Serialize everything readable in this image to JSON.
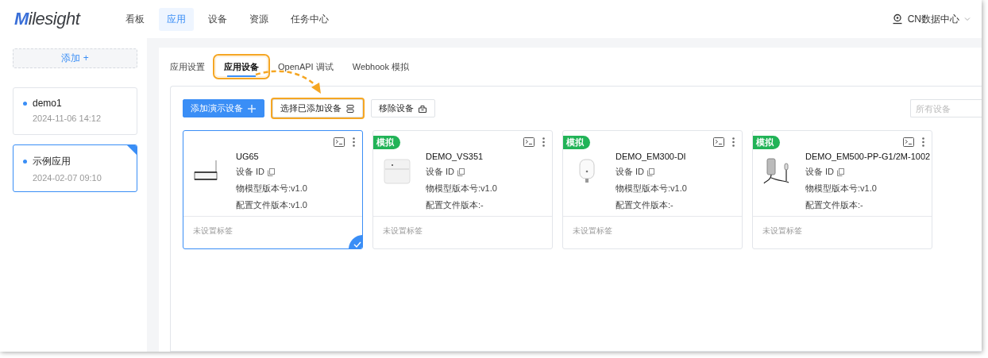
{
  "logo": "Milesight",
  "nav": [
    {
      "label": "看板",
      "selected": false
    },
    {
      "label": "应用",
      "selected": true
    },
    {
      "label": "设备",
      "selected": false
    },
    {
      "label": "资源",
      "selected": false
    },
    {
      "label": "任务中心",
      "selected": false
    }
  ],
  "region": "CN数据中心",
  "sidebar": {
    "add_button": "添加 +",
    "apps": [
      {
        "name": "demo1",
        "date": "2024-11-06 14:12",
        "selected": false
      },
      {
        "name": "示例应用",
        "date": "2024-02-07 09:10",
        "selected": true
      }
    ]
  },
  "tabs": [
    {
      "label": "应用设置",
      "selected": false,
      "highlighted": false
    },
    {
      "label": "应用设备",
      "selected": true,
      "highlighted": true
    },
    {
      "label": "OpenAPI 调试",
      "selected": false,
      "highlighted": false
    },
    {
      "label": "Webhook 模拟",
      "selected": false,
      "highlighted": false
    }
  ],
  "annotation_arrow": true,
  "toolbar": {
    "buttons": [
      {
        "kind": "primary",
        "label": "添加演示设备",
        "highlighted": false
      },
      {
        "kind": "default",
        "label": "选择已添加设备",
        "highlighted": true
      },
      {
        "kind": "default",
        "label": "移除设备",
        "highlighted": false
      }
    ],
    "filter": {
      "placeholder": "所有设备"
    }
  },
  "devices": [
    {
      "name": "UG65",
      "kind": "gateway",
      "simulated": false,
      "selected": true,
      "id_label": "设备 ID",
      "model_version": "物模型版本号:v1.0",
      "config_version": "配置文件版本:v1.0",
      "tags": "未设置标签"
    },
    {
      "name": "DEMO_VS351",
      "kind": "box",
      "simulated": true,
      "badge": "模拟",
      "selected": false,
      "id_label": "设备 ID",
      "model_version": "物模型版本号:v1.0",
      "config_version": "配置文件版本:-",
      "tags": "未设置标签"
    },
    {
      "name": "DEMO_EM300-DI",
      "kind": "sensor",
      "simulated": true,
      "badge": "模拟",
      "selected": false,
      "id_label": "设备 ID",
      "model_version": "物模型版本号:v1.0",
      "config_version": "配置文件版本:-",
      "tags": "未设置标签"
    },
    {
      "name": "DEMO_EM500-PP-G1/2M-1002",
      "kind": "probe",
      "simulated": true,
      "badge": "模拟",
      "selected": false,
      "id_label": "设备 ID",
      "model_version": "物模型版本号:v1.0",
      "config_version": "配置文件版本:-",
      "tags": "未设置标签"
    }
  ]
}
